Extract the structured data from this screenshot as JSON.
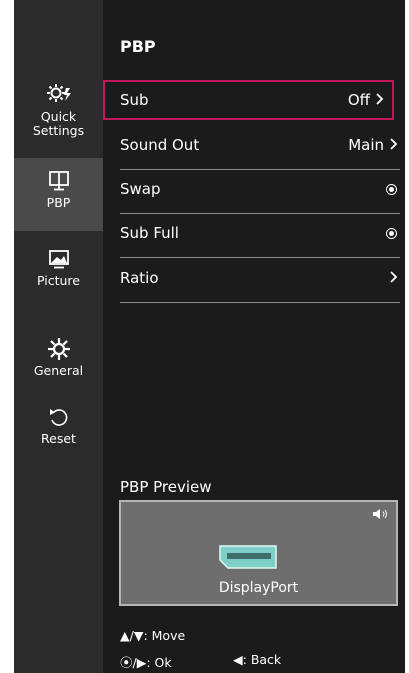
{
  "sidebar": {
    "items": [
      {
        "label": "Quick\nSettings",
        "icon": "quick-settings-icon"
      },
      {
        "label": "PBP",
        "icon": "pbp-icon",
        "selected": true
      },
      {
        "label": "Picture",
        "icon": "picture-icon"
      },
      {
        "label": "General",
        "icon": "gear-icon"
      },
      {
        "label": "Reset",
        "icon": "reset-icon"
      }
    ]
  },
  "main": {
    "title": "PBP",
    "rows": [
      {
        "label": "Sub",
        "value": "Off",
        "control": "chevron",
        "selected": true
      },
      {
        "label": "Sound Out",
        "value": "Main",
        "control": "chevron"
      },
      {
        "label": "Swap",
        "value": "",
        "control": "radio"
      },
      {
        "label": "Sub Full",
        "value": "",
        "control": "radio"
      },
      {
        "label": "Ratio",
        "value": "",
        "control": "chevron"
      }
    ],
    "preview": {
      "label": "PBP Preview",
      "source": "DisplayPort",
      "speaker_icon": "speaker-icon"
    }
  },
  "footer": {
    "move": "Move",
    "ok": "Ok",
    "back": "Back"
  },
  "colors": {
    "selection_border": "#c2185b",
    "sidebar_bg": "#2b2b2b",
    "panel_bg": "#1b1b1b",
    "connector": "#7ecfc8"
  }
}
